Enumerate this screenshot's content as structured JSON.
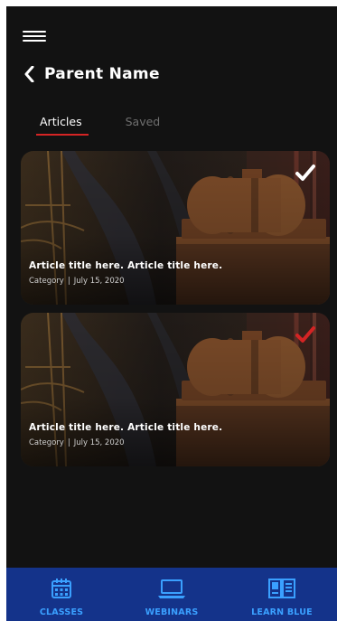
{
  "header": {
    "title": "Parent Name"
  },
  "tabs": [
    {
      "label": "Articles",
      "active": true
    },
    {
      "label": "Saved",
      "active": false
    }
  ],
  "articles": [
    {
      "title": "Article title here. Article title here.",
      "category": "Category",
      "separator": "|",
      "date": "July 15, 2020",
      "check_color": "#ffffff"
    },
    {
      "title": "Article title here. Article title here.",
      "category": "Category",
      "separator": "|",
      "date": "July 15, 2020",
      "check_color": "#d42424"
    }
  ],
  "bottom_nav": [
    {
      "label": "CLASSES",
      "icon": "calendar-icon"
    },
    {
      "label": "WEBINARS",
      "icon": "laptop-icon"
    },
    {
      "label": "LEARN BLUE",
      "icon": "book-icon"
    }
  ],
  "colors": {
    "accent": "#d42424",
    "nav_bg": "#14338a",
    "nav_fg": "#3aa0ff"
  }
}
